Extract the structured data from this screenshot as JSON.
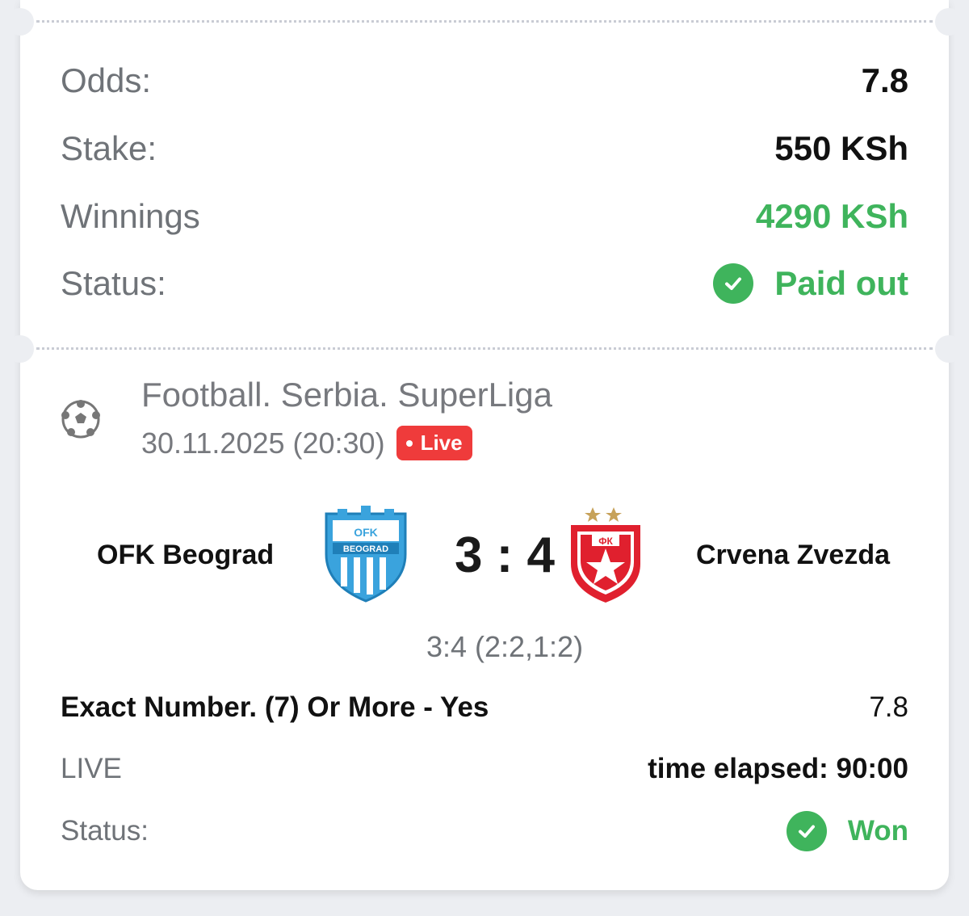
{
  "summary": {
    "odds_label": "Odds:",
    "odds_value": "7.8",
    "stake_label": "Stake:",
    "stake_value": "550 KSh",
    "winnings_label": "Winnings",
    "winnings_value": "4290 KSh",
    "status_label": "Status:",
    "status_value": "Paid out"
  },
  "event": {
    "league": "Football. Serbia. SuperLiga",
    "datetime": "30.11.2025 (20:30)",
    "live_badge": "Live",
    "home_team": "OFK Beograd",
    "away_team": "Crvena Zvezda",
    "score": "3 : 4",
    "score_detail": "3:4 (2:2,1:2)",
    "home_logo_text": "BEOGRAD",
    "home_logo_letters": "OFK",
    "away_logo_text": "ФК"
  },
  "bet": {
    "market": "Exact Number. (7) Or More - Yes",
    "odds": "7.8",
    "mode": "LIVE",
    "elapsed": "time elapsed: 90:00",
    "status_label": "Status:",
    "status_value": "Won"
  },
  "colors": {
    "success": "#3fb45c",
    "live": "#ef3b3b",
    "home_blue": "#3aa3dd",
    "away_red": "#e0202e"
  },
  "icons": [
    "check-circle-icon",
    "football-icon"
  ]
}
